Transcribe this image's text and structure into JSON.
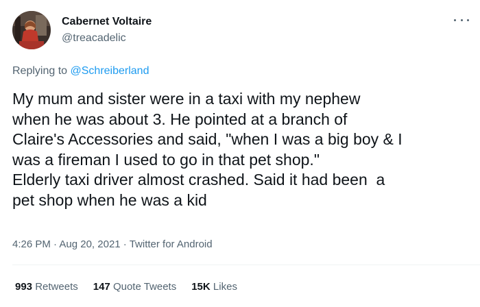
{
  "tweet": {
    "display_name": "Cabernet Voltaire",
    "handle": "@treacadelic",
    "replying_prefix": "Replying to ",
    "replying_to": "@Schreiberland",
    "text": "My mum and sister were in a taxi with my nephew\nwhen he was about 3. He pointed at a branch of\nClaire's Accessories and said, \"when I was a big boy & I\nwas a fireman I used to go in that pet shop.\"\nElderly taxi driver almost crashed. Said it had been  a\npet shop when he was a kid",
    "time": "4:26 PM",
    "separator": " · ",
    "date": "Aug 20, 2021",
    "source": "Twitter for Android",
    "stats": {
      "retweets_count": "993",
      "retweets_label": "Retweets",
      "quotes_count": "147",
      "quotes_label": "Quote Tweets",
      "likes_count": "15K",
      "likes_label": "Likes"
    }
  },
  "icons": {
    "more": "more-horizontal-icon",
    "avatar": "user-avatar-image"
  },
  "colors": {
    "text_primary": "#0f1419",
    "text_secondary": "#536471",
    "link": "#1d9bf0",
    "divider": "#eff3f4"
  }
}
